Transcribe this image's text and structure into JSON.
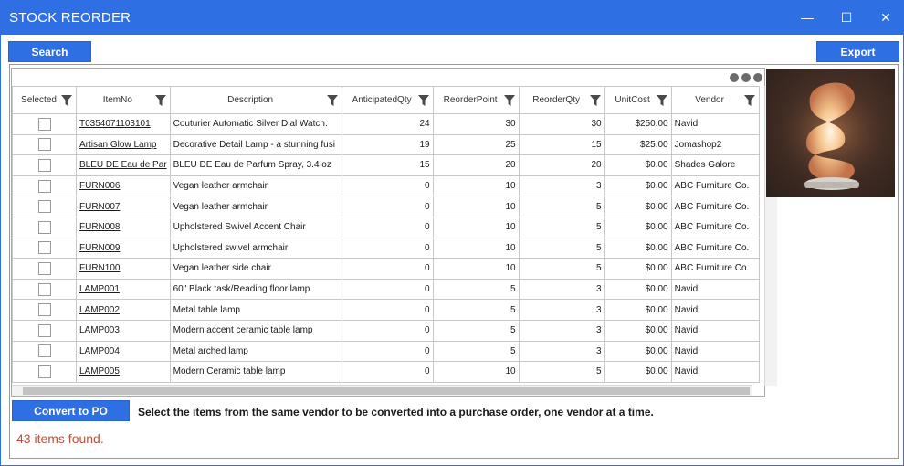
{
  "window": {
    "title": "STOCK REORDER",
    "minimize_glyph": "—",
    "maximize_glyph": "☐",
    "close_glyph": "✕"
  },
  "toolbar": {
    "search_label": "Search",
    "export_label": "Export"
  },
  "grid": {
    "columns": [
      "Selected",
      "ItemNo",
      "Description",
      "AnticipatedQty",
      "ReorderPoint",
      "ReorderQty",
      "UnitCost",
      "Vendor"
    ],
    "rows": [
      {
        "item": "T0354071103101",
        "desc": "Couturier Automatic Silver Dial Watch.",
        "aq": "24",
        "rp": "30",
        "rq": "30",
        "cost": "$250.00",
        "vendor": "Navid"
      },
      {
        "item": "Artisan Glow Lamp",
        "desc": "Decorative Detail Lamp - a stunning fusi",
        "aq": "19",
        "rp": "25",
        "rq": "15",
        "cost": "$25.00",
        "vendor": "Jomashop2"
      },
      {
        "item": "BLEU DE Eau de Par",
        "desc": "BLEU DE Eau de Parfum Spray, 3.4 oz",
        "aq": "15",
        "rp": "20",
        "rq": "20",
        "cost": "$0.00",
        "vendor": "Shades Galore"
      },
      {
        "item": "FURN006",
        "desc": "Vegan leather armchair",
        "aq": "0",
        "rp": "10",
        "rq": "3",
        "cost": "$0.00",
        "vendor": "ABC Furniture Co."
      },
      {
        "item": "FURN007",
        "desc": "Vegan leather armchair",
        "aq": "0",
        "rp": "10",
        "rq": "5",
        "cost": "$0.00",
        "vendor": "ABC Furniture Co."
      },
      {
        "item": "FURN008",
        "desc": "Upholstered Swivel Accent Chair",
        "aq": "0",
        "rp": "10",
        "rq": "5",
        "cost": "$0.00",
        "vendor": "ABC Furniture Co."
      },
      {
        "item": "FURN009",
        "desc": "Upholstered swivel armchair",
        "aq": "0",
        "rp": "10",
        "rq": "5",
        "cost": "$0.00",
        "vendor": "ABC Furniture Co."
      },
      {
        "item": "FURN100",
        "desc": "Vegan leather side chair",
        "aq": "0",
        "rp": "10",
        "rq": "5",
        "cost": "$0.00",
        "vendor": "ABC Furniture Co."
      },
      {
        "item": "LAMP001",
        "desc": "60\" Black task/Reading floor lamp",
        "aq": "0",
        "rp": "5",
        "rq": "3",
        "cost": "$0.00",
        "vendor": "Navid"
      },
      {
        "item": "LAMP002",
        "desc": "Metal table lamp",
        "aq": "0",
        "rp": "5",
        "rq": "3",
        "cost": "$0.00",
        "vendor": "Navid"
      },
      {
        "item": "LAMP003",
        "desc": "Modern accent ceramic table lamp",
        "aq": "0",
        "rp": "5",
        "rq": "3",
        "cost": "$0.00",
        "vendor": "Navid"
      },
      {
        "item": "LAMP004",
        "desc": " Metal arched lamp",
        "aq": "0",
        "rp": "5",
        "rq": "3",
        "cost": "$0.00",
        "vendor": "Navid"
      },
      {
        "item": "LAMP005",
        "desc": "Modern Ceramic table lamp",
        "aq": "0",
        "rp": "10",
        "rq": "5",
        "cost": "$0.00",
        "vendor": "Navid"
      }
    ]
  },
  "footer": {
    "convert_label": "Convert to PO",
    "instruction": "Select the items from the same vendor to be converted into a purchase order, one vendor at a time.",
    "count_text": "43 items found."
  },
  "colors": {
    "accent": "#2f6fe4",
    "count_text": "#c0503a"
  }
}
